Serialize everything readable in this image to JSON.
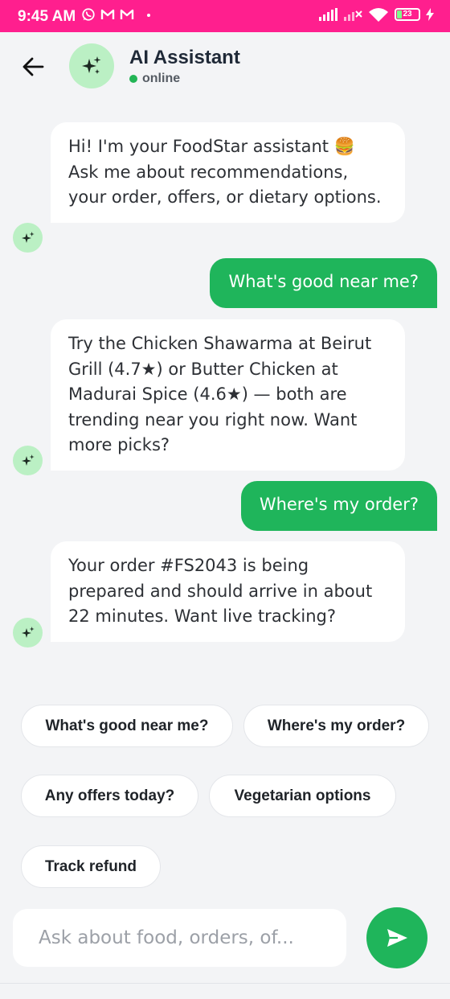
{
  "status_bar": {
    "time": "9:45 AM",
    "battery": "23",
    "colors": {
      "background": "#ff1f8e"
    }
  },
  "header": {
    "title": "AI Assistant",
    "status": "online",
    "avatar_icon": "sparkles-icon",
    "back_icon": "arrow-left-icon"
  },
  "messages": [
    {
      "role": "bot",
      "text": "Hi! I'm your FoodStar assistant 🍔 Ask me about recommendations, your order, offers, or dietary options."
    },
    {
      "role": "user",
      "text": "What's good near me?"
    },
    {
      "role": "bot",
      "text": "Try the Chicken Shawarma at Beirut Grill (4.7★) or Butter Chicken at Madurai Spice (4.6★) — both are trending near you right now. Want more picks?"
    },
    {
      "role": "user",
      "text": "Where's my order?"
    },
    {
      "role": "bot",
      "text": "Your order #FS2043 is being prepared and should arrive in about 22 minutes. Want live tracking?"
    }
  ],
  "suggestions": [
    "What's good near me?",
    "Where's my order?",
    "Any offers today?",
    "Vegetarian options",
    "Track refund"
  ],
  "composer": {
    "placeholder": "Ask about food, orders, of...",
    "value": "",
    "send_icon": "send-icon"
  },
  "colors": {
    "accent": "#1fb55b",
    "avatar_bg": "#bbf0c4",
    "page_bg": "#f3f4f6"
  }
}
